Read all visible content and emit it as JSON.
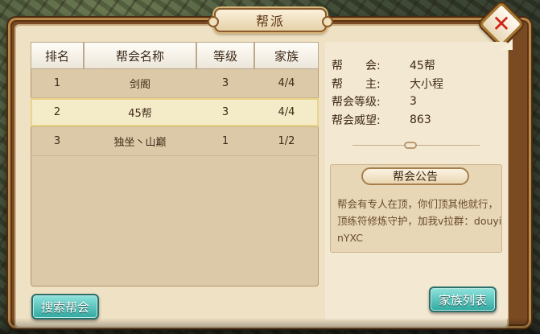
{
  "window": {
    "title": "帮派"
  },
  "close": {
    "label": "✕"
  },
  "table": {
    "headers": [
      "排名",
      "帮会名称",
      "等级",
      "家族"
    ],
    "rows": [
      {
        "rank": "1",
        "name": "剑阁",
        "level": "3",
        "families": "4/4"
      },
      {
        "rank": "2",
        "name": "45帮",
        "level": "3",
        "families": "4/4"
      },
      {
        "rank": "3",
        "name": "独坐丶山巅",
        "level": "1",
        "families": "1/2"
      }
    ],
    "selected_rank": "2"
  },
  "detail": {
    "gang_label": "帮　　会:",
    "gang_value": "45帮",
    "leader_label": "帮　　主:",
    "leader_value": "大小程",
    "level_label": "帮会等级:",
    "level_value": "3",
    "prestige_label": "帮会威望:",
    "prestige_value": "863"
  },
  "notice": {
    "title": "帮会公告",
    "text": "帮会有专人在顶，你们顶其他就行，顶练符修炼守护，加我v拉群：douyinYXC"
  },
  "buttons": {
    "search": "搜索帮会",
    "family_list": "家族列表"
  }
}
